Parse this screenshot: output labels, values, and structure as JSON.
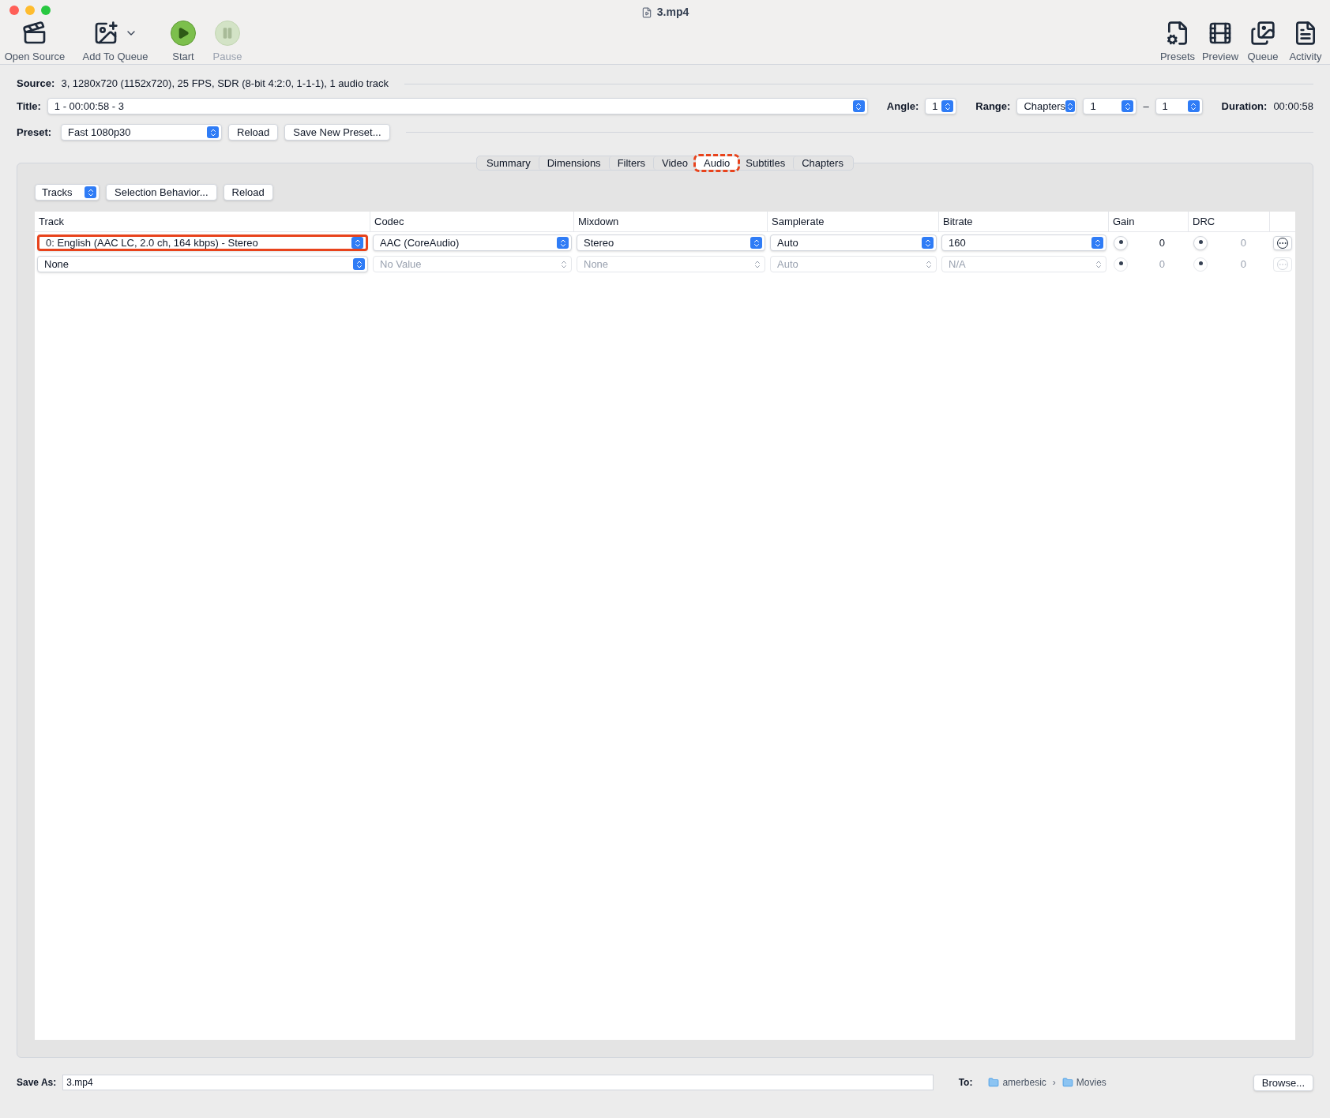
{
  "window": {
    "title": "3.mp4"
  },
  "toolbar_left": [
    {
      "label": "Open Source",
      "kind": "clapper",
      "disabled": false
    },
    {
      "label": "Add To Queue",
      "kind": "addqueue",
      "disabled": false
    },
    {
      "label": "Start",
      "kind": "play",
      "disabled": false
    },
    {
      "label": "Pause",
      "kind": "pause",
      "disabled": true
    }
  ],
  "toolbar_right": [
    {
      "label": "Presets",
      "kind": "presets",
      "disabled": false
    },
    {
      "label": "Preview",
      "kind": "preview",
      "disabled": false
    },
    {
      "label": "Queue",
      "kind": "queue",
      "disabled": false
    },
    {
      "label": "Activity",
      "kind": "activity",
      "disabled": false
    }
  ],
  "source": {
    "label": "Source:",
    "value": "3, 1280x720 (1152x720), 25 FPS, SDR (8-bit 4:2:0, 1-1-1), 1 audio track"
  },
  "title_row": {
    "label": "Title:",
    "value": "1 - 00:00:58 - 3",
    "angle_label": "Angle:",
    "angle": "1",
    "range_label": "Range:",
    "range": "Chapters",
    "range_from": "1",
    "range_sep": "–",
    "range_to": "1",
    "duration_label": "Duration:",
    "duration": "00:00:58"
  },
  "preset_row": {
    "label": "Preset:",
    "value": "Fast 1080p30",
    "buttons": [
      "Reload",
      "Save New Preset..."
    ]
  },
  "tabs": [
    {
      "label": "Summary",
      "selected": false,
      "highlighted": false
    },
    {
      "label": "Dimensions",
      "selected": false,
      "highlighted": false
    },
    {
      "label": "Filters",
      "selected": false,
      "highlighted": false
    },
    {
      "label": "Video",
      "selected": false,
      "highlighted": false
    },
    {
      "label": "Audio",
      "selected": true,
      "highlighted": true
    },
    {
      "label": "Subtitles",
      "selected": false,
      "highlighted": false
    },
    {
      "label": "Chapters",
      "selected": false,
      "highlighted": false
    }
  ],
  "audio_toolbar": {
    "tracks_popup": "Tracks",
    "buttons": [
      "Selection Behavior...",
      "Reload"
    ]
  },
  "table": {
    "columns": [
      "Track",
      "Codec",
      "Mixdown",
      "Samplerate",
      "Bitrate",
      "Gain",
      "DRC"
    ],
    "rows": [
      {
        "track": "0: English (AAC LC, 2.0 ch, 164 kbps) - Stereo",
        "codec": "AAC (CoreAudio)",
        "mixdown": "Stereo",
        "samplerate": "Auto",
        "bitrate": "160",
        "gain": "0",
        "drc": "0",
        "disabled": false,
        "highlighted": true
      },
      {
        "track": "None",
        "codec": "No Value",
        "mixdown": "None",
        "samplerate": "Auto",
        "bitrate": "N/A",
        "gain": "0",
        "drc": "0",
        "disabled": true,
        "highlighted": false
      }
    ]
  },
  "save_row": {
    "label": "Save As:",
    "value": "3.mp4",
    "to_label": "To:",
    "path": [
      "amerbesic",
      "Movies"
    ],
    "path_sep": "›",
    "browse": "Browse..."
  }
}
